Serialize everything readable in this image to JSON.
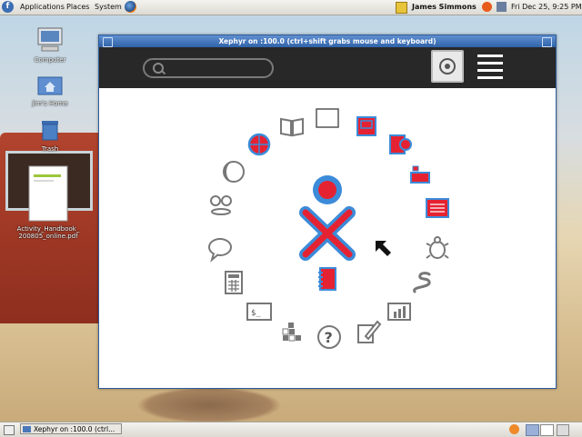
{
  "top_panel": {
    "menus": [
      "Applications",
      "Places",
      "System"
    ],
    "user": "James Simmons",
    "clock": "Fri Dec 25,  9:25 PM"
  },
  "desktop": {
    "icons": [
      {
        "label": "Computer",
        "icon": "computer-icon"
      },
      {
        "label": "jim's Home",
        "icon": "home-folder-icon"
      },
      {
        "label": "Trash",
        "icon": "trash-icon"
      },
      {
        "label": "Activity_Handbook_200805_online.pdf",
        "icon": "pdf-document-icon"
      }
    ]
  },
  "window": {
    "title": "Xephyr on :100.0 (ctrl+shift grabs mouse and keyboard)"
  },
  "sugar": {
    "search_placeholder": "",
    "view_buttons": [
      "home-view-icon",
      "list-view-icon"
    ],
    "activity_icons": [
      "book-reader-icon",
      "blank-document-icon",
      "calendar-red-icon",
      "browse-globe-icon",
      "moon-icon",
      "web-book-icon",
      "memorize-icon",
      "stacked-books-icon",
      "speak-face-icon",
      "bookshelf-icon",
      "chat-bubble-icon",
      "turtle-art-icon",
      "calculator-icon",
      "pippy-snake-icon",
      "terminal-icon",
      "analyze-chart-icon",
      "implode-blocks-icon",
      "help-question-icon",
      "write-pencil-icon",
      "journal-red-icon"
    ],
    "colors": {
      "xo_fill": "#e52232",
      "xo_stroke": "#3c8bd9",
      "toolbar": "#282828"
    }
  },
  "bottom_panel": {
    "taskbar_item": "Xephyr on :100.0 (ctrl..."
  }
}
